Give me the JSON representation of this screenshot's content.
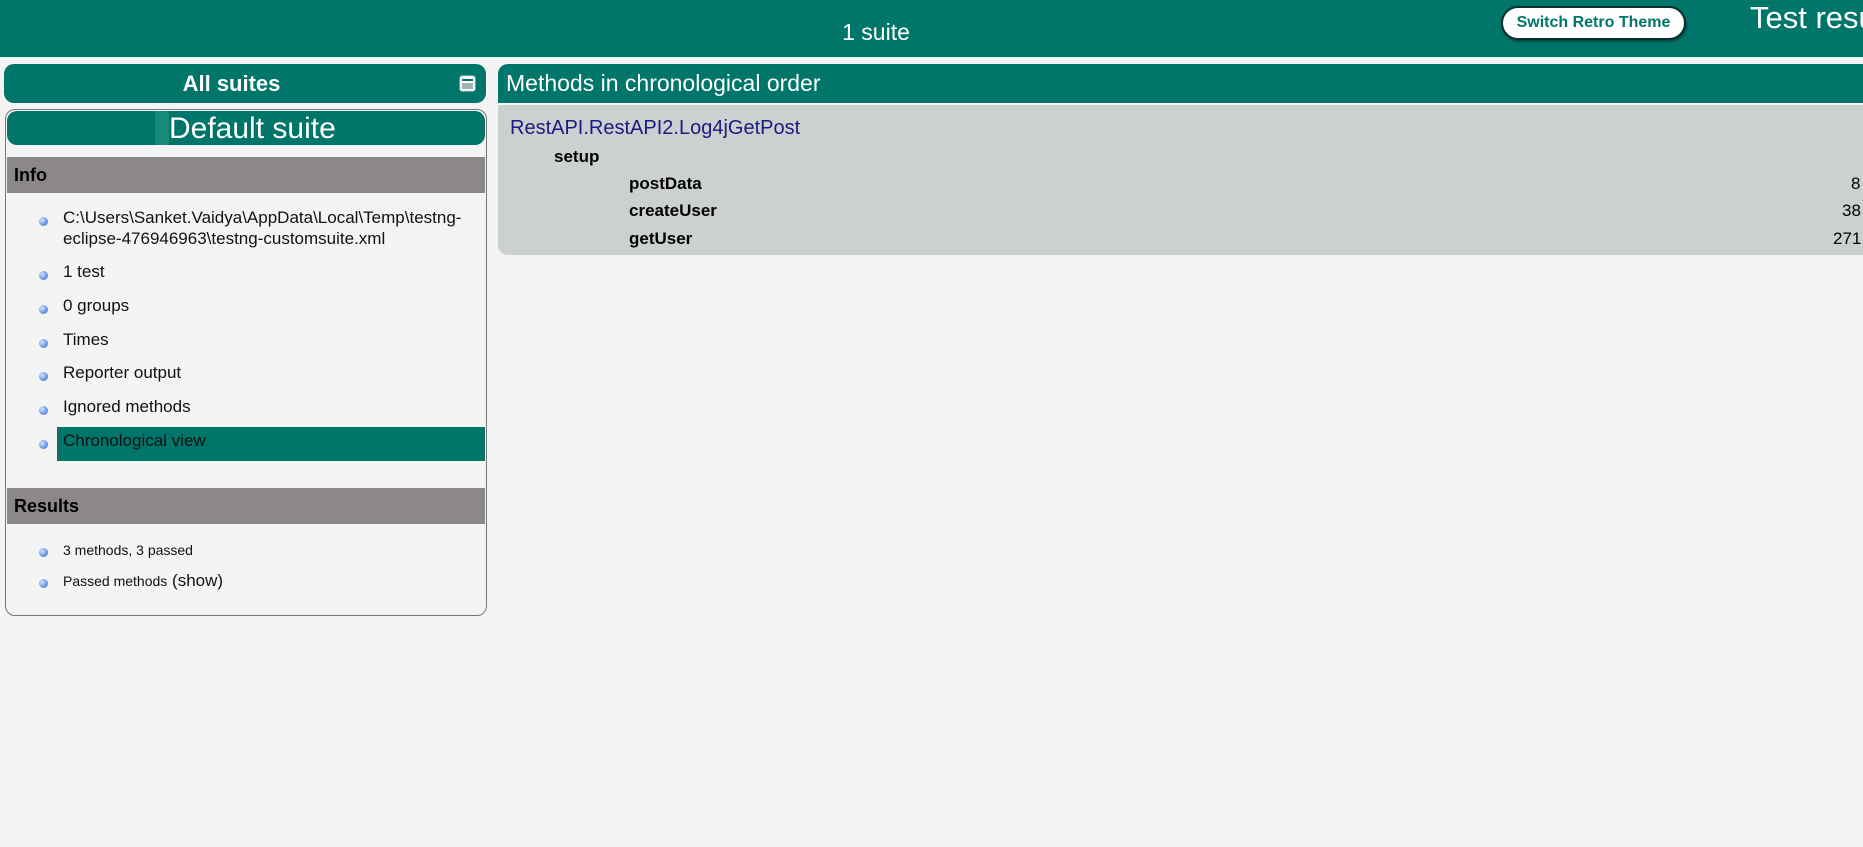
{
  "header": {
    "title": "1 suite",
    "theme_button_label": "Switch Retro Theme",
    "report_title": "Test results"
  },
  "sidebar": {
    "all_suites_label": "All suites",
    "collapse_icon": "collapse-icon",
    "suite_name": "Default suite",
    "info_header": "Info",
    "info_items": {
      "path_line1": "C:\\Users\\Sanket.Vaidya\\AppData\\Local\\Temp\\testng-",
      "path_line2": "eclipse-476946963\\testng-customsuite.xml",
      "tests": "1 test",
      "groups": "0 groups",
      "times": "Times",
      "reporter_output": "Reporter output",
      "ignored_methods": "Ignored methods",
      "chronological_view": "Chronological view"
    },
    "results_header": "Results",
    "results_items": {
      "summary": "3 methods, 3 passed",
      "passed_methods": "Passed methods",
      "show_link": "(show)"
    }
  },
  "main": {
    "header": "Methods in chronological order",
    "class_name": "RestAPI.RestAPI2.Log4jGetPost",
    "setup_label": "setup",
    "methods": [
      {
        "name": "postData",
        "time": "8"
      },
      {
        "name": "createUser",
        "time": "38"
      },
      {
        "name": "getUser",
        "time": "271"
      }
    ]
  },
  "colors": {
    "primary": "#00756a",
    "section_header": "#8c8888",
    "methods_panel": "#cdd0d0",
    "link": "#1a1a80",
    "background": "#f4f4f4"
  }
}
